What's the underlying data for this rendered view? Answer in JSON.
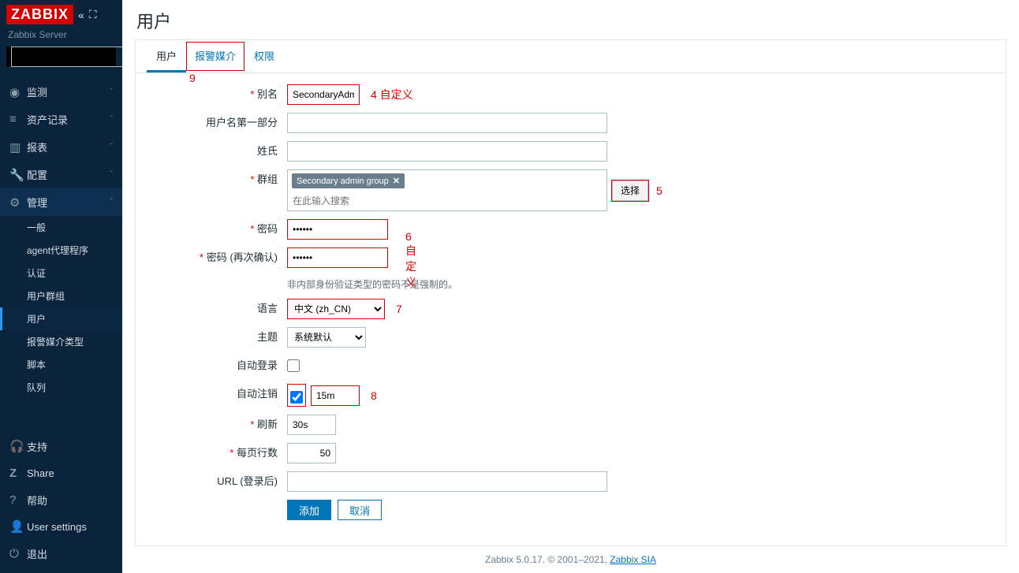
{
  "brand": {
    "logo": "ZABBIX",
    "server": "Zabbix Server"
  },
  "sidebar": {
    "nav": [
      {
        "icon": "◉",
        "label": "监测"
      },
      {
        "icon": "≡",
        "label": "资产记录"
      },
      {
        "icon": "▥",
        "label": "报表"
      },
      {
        "icon": "🔧",
        "label": "配置"
      },
      {
        "icon": "⚙",
        "label": "管理"
      }
    ],
    "sub": [
      "一般",
      "agent代理程序",
      "认证",
      "用户群组",
      "用户",
      "报警媒介类型",
      "脚本",
      "队列"
    ],
    "bottom": [
      {
        "icon": "🎧",
        "label": "支持"
      },
      {
        "icon": "Z",
        "label": "Share"
      },
      {
        "icon": "?",
        "label": "帮助"
      },
      {
        "icon": "👤",
        "label": "User settings"
      },
      {
        "icon": "⏻",
        "label": "退出"
      }
    ]
  },
  "page": {
    "title": "用户"
  },
  "tabs": [
    "用户",
    "报警媒介",
    "权限"
  ],
  "annotations": {
    "a4": "4  自定义",
    "a5": "5",
    "a6": "6  自定义",
    "a7": "7",
    "a8": "8",
    "a9": "9"
  },
  "form": {
    "alias_label": "别名",
    "alias_value": "SecondaryAdmin",
    "firstname_label": "用户名第一部分",
    "firstname_value": "",
    "surname_label": "姓氏",
    "surname_value": "",
    "group_label": "群组",
    "group_tag": "Secondary admin group",
    "group_placeholder": "在此输入搜索",
    "select_btn": "选择",
    "password_label": "密码",
    "password_value": "••••••",
    "password2_label": "密码 (再次确认)",
    "password2_value": "••••••",
    "password_hint": "非内部身份验证类型的密码不是强制的。",
    "lang_label": "语言",
    "lang_value": "中文 (zh_CN)",
    "theme_label": "主题",
    "theme_value": "系统默认",
    "autologin_label": "自动登录",
    "autologout_label": "自动注销",
    "autologout_value": "15m",
    "refresh_label": "刷新",
    "refresh_value": "30s",
    "rows_label": "每页行数",
    "rows_value": "50",
    "url_label": "URL (登录后)",
    "url_value": "",
    "add_btn": "添加",
    "cancel_btn": "取消"
  },
  "footer": {
    "text": "Zabbix 5.0.17. © 2001–2021, ",
    "link": "Zabbix SIA"
  }
}
